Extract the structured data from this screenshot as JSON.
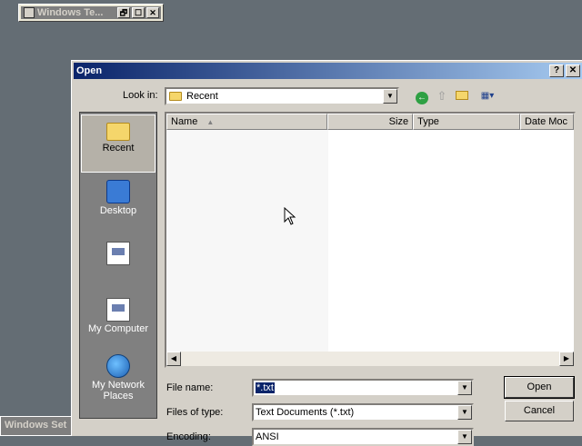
{
  "mini_window": {
    "title": "Windows Te...",
    "restore": "🗗",
    "maximize": "☐",
    "close": "✕"
  },
  "taskbar_fragment": {
    "label": "Windows Set"
  },
  "dialog": {
    "title": "Open",
    "help_btn": "?",
    "close_btn": "✕",
    "look_in": {
      "label": "Look in:",
      "value": "Recent"
    },
    "toolbar": {
      "back_icon": "back-arrow-icon",
      "up_icon": "up-folder-icon",
      "new_folder_icon": "new-folder-icon",
      "views_icon": "views-icon"
    },
    "places": [
      {
        "label": "Recent",
        "icon": "recent-folder-icon",
        "selected": true
      },
      {
        "label": "Desktop",
        "icon": "desktop-icon"
      },
      {
        "label": "",
        "icon": "document-icon"
      },
      {
        "label": "My Computer",
        "icon": "my-computer-icon"
      },
      {
        "label": "My Network Places",
        "icon": "network-icon"
      }
    ],
    "columns": [
      "Name",
      "Size",
      "Type",
      "Date Moc"
    ],
    "file_name": {
      "label": "File name:",
      "value": "*.txt"
    },
    "files_of_type": {
      "label": "Files of type:",
      "value": "Text Documents (*.txt)"
    },
    "encoding": {
      "label": "Encoding:",
      "value": "ANSI"
    },
    "buttons": {
      "open": "Open",
      "cancel": "Cancel"
    }
  }
}
